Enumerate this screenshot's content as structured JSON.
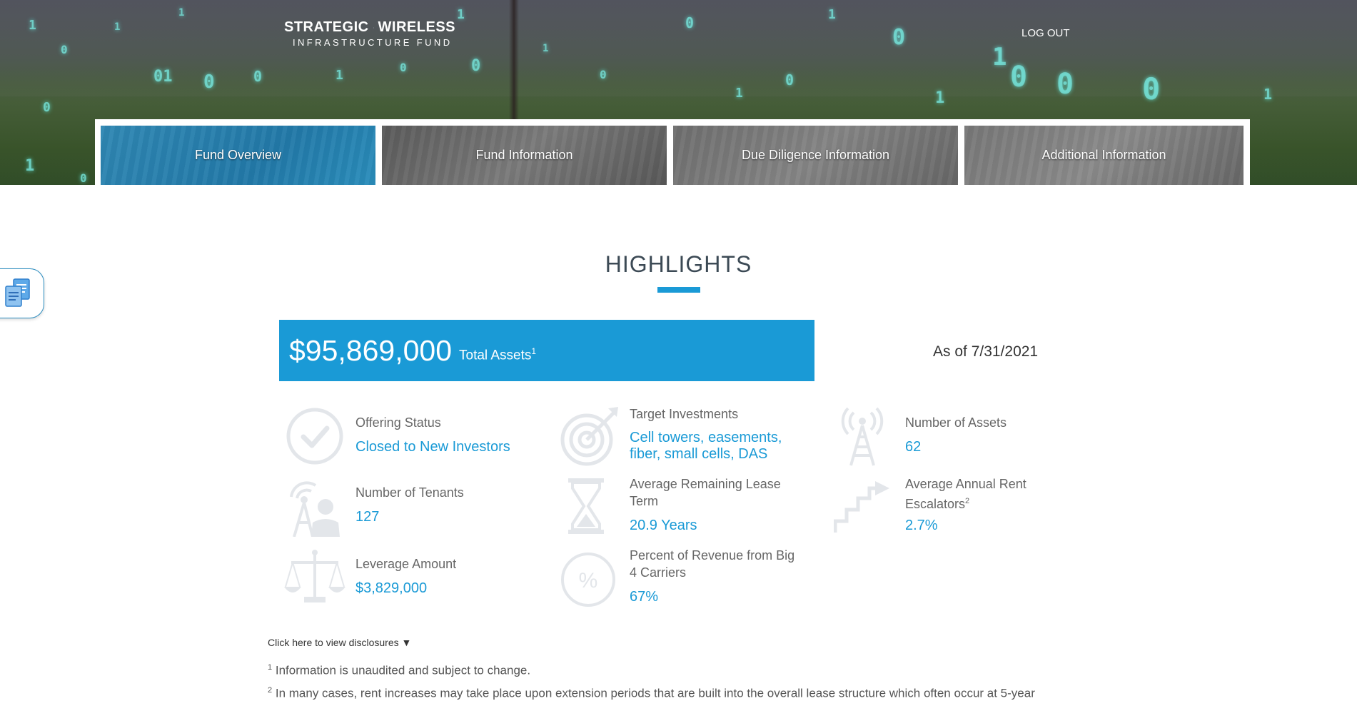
{
  "header": {
    "logo_line1_a": "STRATEGIC",
    "logo_line1_b": "WIRELESS",
    "logo_line2": "INFRASTRUCTURE FUND",
    "logout_label": "LOG OUT"
  },
  "tabs": [
    {
      "label": "Fund Overview",
      "active": true
    },
    {
      "label": "Fund Information",
      "active": false
    },
    {
      "label": "Due Diligence Information",
      "active": false
    },
    {
      "label": "Additional Information",
      "active": false
    }
  ],
  "highlights": {
    "title": "HIGHLIGHTS",
    "total_amount": "$95,869,000",
    "total_label": "Total Assets",
    "total_sup": "1",
    "as_of": "As of 7/31/2021",
    "stats": [
      {
        "icon": "checkmark-circle-icon",
        "label": "Offering Status",
        "value": "Closed to New Investors"
      },
      {
        "icon": "target-icon",
        "label": "Target Investments",
        "value": "Cell towers, easements, fiber, small cells, DAS"
      },
      {
        "icon": "cell-tower-icon",
        "label": "Number of Assets",
        "value": "62"
      },
      {
        "icon": "tenant-tower-icon",
        "label": "Number of Tenants",
        "value": "127"
      },
      {
        "icon": "hourglass-icon",
        "label": "Average Remaining Lease Term",
        "value": "20.9 Years"
      },
      {
        "icon": "stairs-arrow-icon",
        "label": "Average Annual Rent Escalators",
        "label_sup": "2",
        "value": "2.7%"
      },
      {
        "icon": "scale-icon",
        "label": "Leverage Amount",
        "value": "$3,829,000"
      },
      {
        "icon": "percent-circle-icon",
        "label": "Percent of Revenue from Big 4 Carriers",
        "value": "67%"
      }
    ]
  },
  "disclosures": {
    "toggle_label": "Click here to view disclosures ▼",
    "note1_sup": "1",
    "note1": "Information is unaudited and subject to change.",
    "note2_sup": "2",
    "note2": "In many cases, rent increases may take place upon extension periods that are built into the overall lease structure which often occur at 5-year"
  },
  "colors": {
    "accent": "#1a9ad6",
    "icon_gray": "#e3e6ea",
    "title": "#3c4a55"
  }
}
